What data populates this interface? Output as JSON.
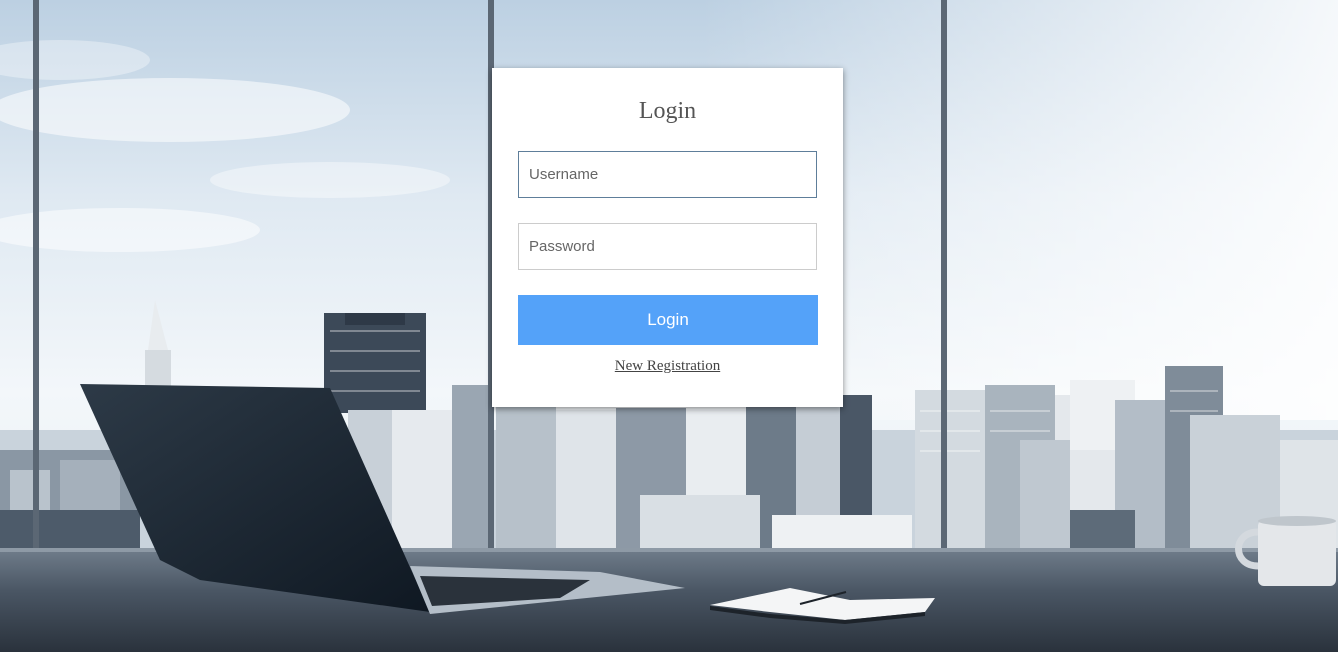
{
  "login": {
    "title": "Login",
    "username_placeholder": "Username",
    "password_placeholder": "Password",
    "button_label": "Login",
    "register_link": "New Registration"
  },
  "colors": {
    "button": "#54a2f9",
    "card": "#ffffff"
  }
}
